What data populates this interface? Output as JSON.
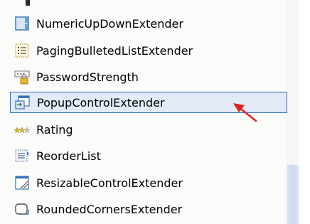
{
  "toolbox": {
    "items": [
      {
        "label": "NumericUpDownExtender",
        "icon": "numeric-updown-icon"
      },
      {
        "label": "PagingBulletedListExtender",
        "icon": "bulleted-list-icon"
      },
      {
        "label": "PasswordStrength",
        "icon": "password-strength-icon"
      },
      {
        "label": "PopupControlExtender",
        "icon": "popup-control-icon",
        "selected": true
      },
      {
        "label": "Rating",
        "icon": "rating-stars-icon"
      },
      {
        "label": "ReorderList",
        "icon": "reorder-list-icon"
      },
      {
        "label": "ResizableControlExtender",
        "icon": "resizable-control-icon"
      },
      {
        "label": "RoundedCornersExtender",
        "icon": "rounded-corners-icon"
      }
    ]
  },
  "annotation": {
    "arrow_color": "#e0221f",
    "points_to": "PopupControlExtender"
  },
  "colors": {
    "selection_border": "#316ac5",
    "selection_fill": "#e3ebf8",
    "scroll_thumb": "#cfd9ef"
  }
}
